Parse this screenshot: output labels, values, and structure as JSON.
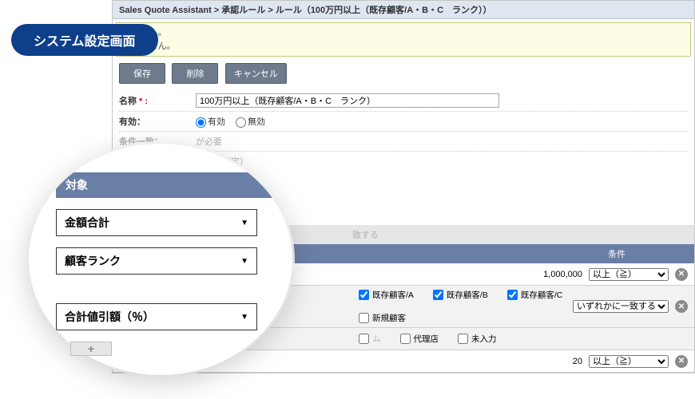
{
  "badge": "システム設定画面",
  "breadcrumb": "Sales Quote Assistant > 承認ルール > ルール（100万円以上（既存顧客/A・B・C　ランク））",
  "info": {
    "l1": "れません。",
    "l2": "別しません。"
  },
  "buttons": {
    "save": "保存",
    "delete": "削除",
    "cancel": "キャンセル"
  },
  "form": {
    "name_label": "名称",
    "name_value": "100万円以上（既存顧客/A・B・C　ランク）",
    "enable_label": "有効：",
    "enable_yes": "有効",
    "enable_no": "無効",
    "cond_label": "条件一致：",
    "cond_hint": "が必要",
    "note": "ールで判定）",
    "star": " * :"
  },
  "cond": {
    "section_hint": "致する",
    "hdr_target": "対象",
    "hdr_cond": "条件",
    "row1_value": "1,000,000",
    "row3_value": "20",
    "op_gte": "以上（≧）",
    "op_any": "いずれかに一致する",
    "chk": {
      "a": "既存顧客/A",
      "b": "既存顧客/B",
      "c": "既存顧客/C",
      "new": "新規顧客",
      "m": "ム",
      "d": "代理店",
      "na": "未入力"
    }
  },
  "spotlight": {
    "header": "対象",
    "sel1": "金額合計",
    "sel2": "顧客ランク",
    "sel3": "合計値引額（％）"
  }
}
